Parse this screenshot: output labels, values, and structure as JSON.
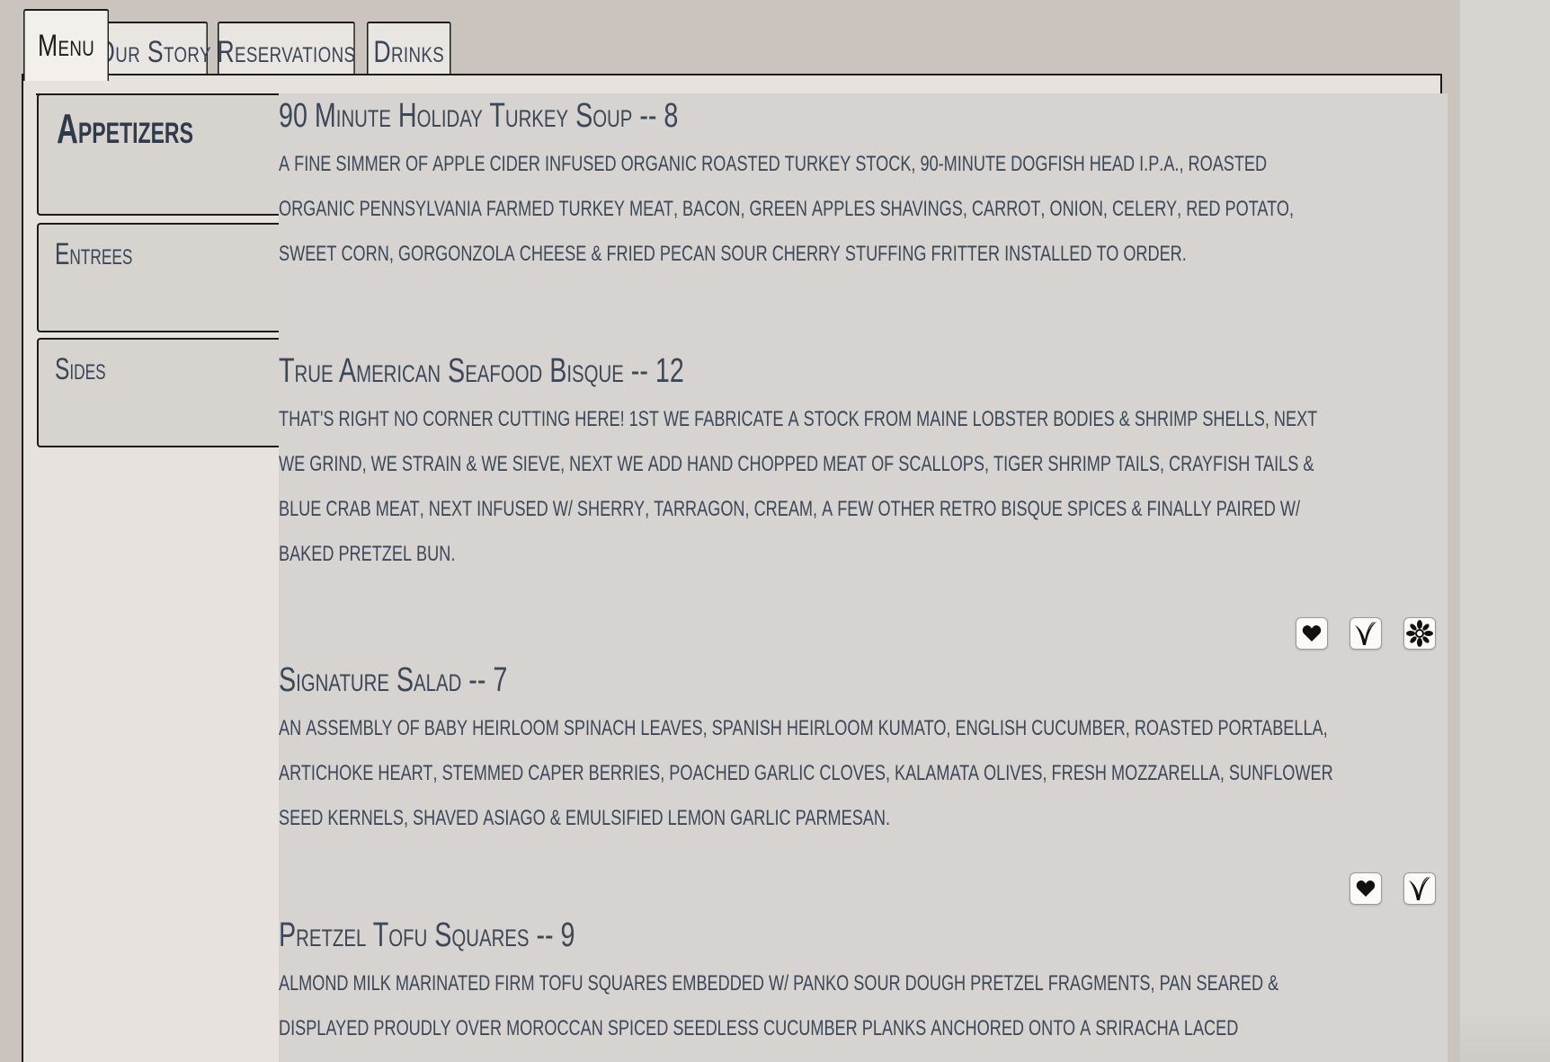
{
  "tabs": [
    {
      "label": "Menu",
      "active": true
    },
    {
      "label": "Our Story",
      "active": false
    },
    {
      "label": "Reservations",
      "active": false
    },
    {
      "label": "Drinks",
      "active": false
    }
  ],
  "categories": [
    {
      "label": "Appetizers",
      "active": true
    },
    {
      "label": "Entrees",
      "active": false
    },
    {
      "label": "Sides",
      "active": false
    }
  ],
  "menu_items": [
    {
      "title": "90 Minute Holiday Turkey Soup -- 8",
      "description": "A fine simmer of apple cider infused organic roasted turkey stock, 90-minute Dogfish Head I.P.A., roasted organic Pennsylvania farmed turkey meat, bacon, green apples shavings, carrot, onion, celery, red potato, sweet corn, gorgonzola cheese & fried pecan sour cherry stuffing fritter installed to order.",
      "icons": []
    },
    {
      "title": "True American Seafood Bisque -- 12",
      "description": "That's right no corner cutting here! 1st we fabricate a stock from Maine lobster bodies & shrimp shells, next we grind, we strain & we sieve, next we add hand chopped meat of scallops, tiger shrimp tails, crayfish tails & blue crab meat, next infused w/ sherry, tarragon, cream, a few other retro bisque spices & finally paired w/ baked pretzel bun.",
      "icons": [
        "heart-icon",
        "vegetarian-icon",
        "gluten-free-icon"
      ]
    },
    {
      "title": "Signature Salad -- 7",
      "description": "An assembly of baby heirloom spinach leaves, Spanish heirloom kumato, English cucumber, roasted portabella, artichoke heart, stemmed caper berries, poached garlic cloves, kalamata olives, fresh mozzarella, sunflower seed kernels, shaved asiago & emulsified lemon garlic parmesan.",
      "icons": [
        "heart-icon",
        "vegetarian-icon"
      ]
    },
    {
      "title": "Pretzel Tofu Squares -- 9",
      "description": "Almond milk marinated firm tofu squares embedded w/ panko sour dough pretzel fragments, pan seared & displayed proudly over Moroccan spiced seedless cucumber planks anchored onto a sriracha laced raspberry lambic beer sauce & finally garnished w/ fried gyu dumpling micro...",
      "icons": []
    }
  ],
  "colors": {
    "background": "#cbc4be",
    "panel": "#e7e2de",
    "content": "#d6d3d0",
    "text": "#3c4758",
    "border": "#1b1b1b"
  }
}
